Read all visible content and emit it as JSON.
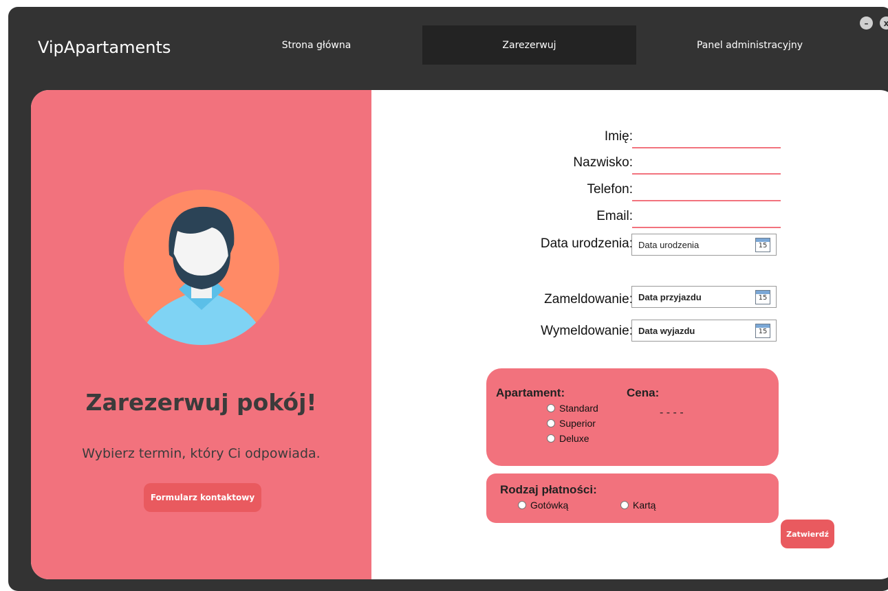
{
  "app": {
    "title": "VipApartaments"
  },
  "nav": {
    "items": [
      {
        "label": "Strona główna"
      },
      {
        "label": "Zarezerwuj"
      },
      {
        "label": "Panel administracyjny"
      }
    ],
    "active": "Zarezerwuj"
  },
  "window_controls": {
    "minimize": "–",
    "close": "x"
  },
  "left": {
    "title": "Zarezerwuj pokój!",
    "subtitle": "Wybierz termin, który Ci odpowiada.",
    "contact_button": "Formularz kontaktowy"
  },
  "form": {
    "first_name_label": "Imię:",
    "last_name_label": "Nazwisko:",
    "phone_label": "Telefon:",
    "email_label": "Email:",
    "birth_label": "Data urodzenia:",
    "birth_placeholder": "Data urodzenia",
    "checkin_label": "Zameldowanie:",
    "checkin_placeholder": "Data przyjazdu",
    "checkout_label": "Wymeldowanie:",
    "checkout_placeholder": "Data wyjazdu",
    "calendar_day": "15"
  },
  "apartment": {
    "label": "Apartament:",
    "options": [
      "Standard",
      "Superior",
      "Deluxe"
    ],
    "price_label": "Cena:",
    "price_value": "- - - -"
  },
  "payment": {
    "label": "Rodzaj płatności:",
    "options": [
      "Gotówką",
      "Kartą"
    ]
  },
  "submit_label": "Zatwierdź",
  "colors": {
    "accent": "#f2727d",
    "button": "#e95a5f",
    "background_dark": "#333333"
  }
}
